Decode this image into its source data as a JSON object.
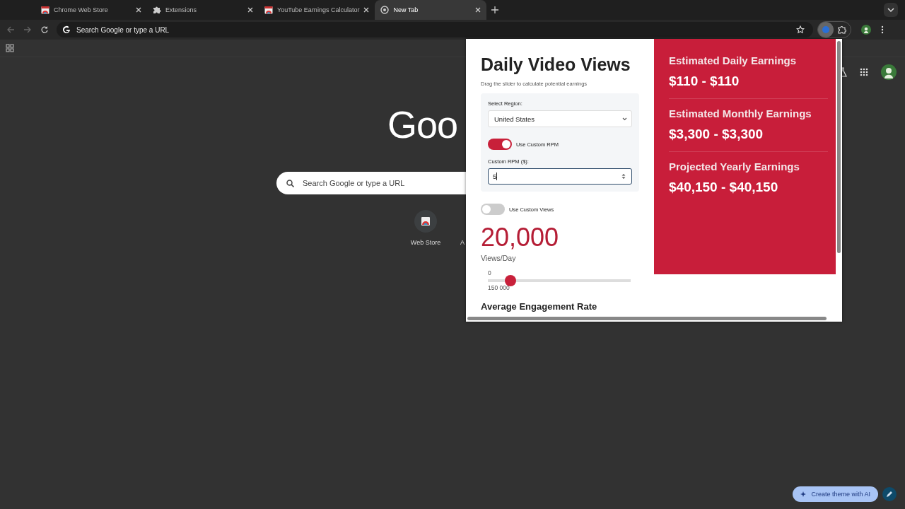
{
  "tabs": [
    {
      "title": "Chrome Web Store",
      "kind": "store",
      "selected": false
    },
    {
      "title": "Extensions",
      "kind": "puzzle",
      "selected": false
    },
    {
      "title": "YouTube Earnings Calculator",
      "kind": "store",
      "selected": false
    },
    {
      "title": "New Tab",
      "kind": "chrome",
      "selected": true
    }
  ],
  "toolbar": {
    "omnibox_placeholder": "Search Google or type a URL"
  },
  "ntp": {
    "logo": "Goo",
    "search_placeholder": "Search Google or type a URL",
    "shortcuts": [
      {
        "label": "Web Store"
      },
      {
        "label": "A"
      }
    ],
    "theme_button": "Create theme with AI"
  },
  "popup": {
    "title": "Daily Video Views",
    "subtitle": "Drag the slider to calculate potential earnings",
    "region_label": "Select Region:",
    "region_value": "United States",
    "custom_rpm": {
      "label": "Use Custom RPM",
      "on": true
    },
    "rpm_field_label": "Custom RPM ($):",
    "rpm_value": "5",
    "custom_views": {
      "label": "Use Custom Views",
      "on": false
    },
    "views": "20,000",
    "views_unit": "Views/Day",
    "slider_min": "0",
    "slider_max": "150 000",
    "slider": {
      "level": 0.16
    },
    "next_heading": "Average Engagement Rate",
    "results": [
      {
        "label": "Estimated Daily Earnings",
        "value": "$110 - $110"
      },
      {
        "label": "Estimated Monthly Earnings",
        "value": "$3,300 - $3,300"
      },
      {
        "label": "Projected Yearly Earnings",
        "value": "$40,150 - $40,150"
      }
    ]
  }
}
